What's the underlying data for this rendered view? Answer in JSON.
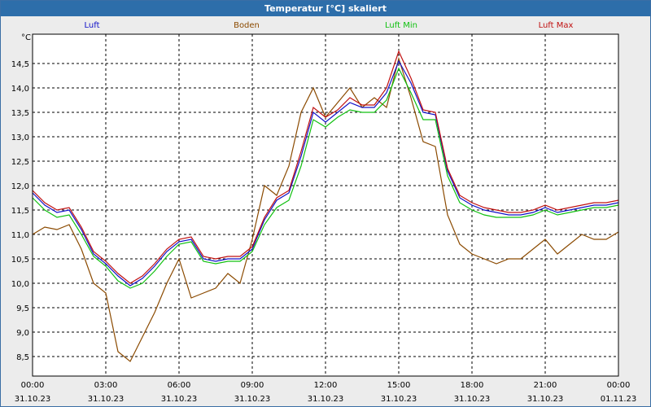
{
  "window": {
    "title": "Temperatur [°C] skaliert"
  },
  "chart_data": {
    "type": "line",
    "title": "Temperatur [°C] skaliert",
    "ylabel": "°C",
    "ylim": [
      8.1,
      15.1
    ],
    "yticks": [
      "8,5",
      "9,0",
      "9,5",
      "10,0",
      "10,5",
      "11,0",
      "11,5",
      "12,0",
      "12,5",
      "13,0",
      "13,5",
      "14,0",
      "14,5"
    ],
    "ytick_values": [
      8.5,
      9.0,
      9.5,
      10.0,
      10.5,
      11.0,
      11.5,
      12.0,
      12.5,
      13.0,
      13.5,
      14.0,
      14.5
    ],
    "xlim_hours": [
      0,
      24
    ],
    "xtick_hours": [
      0,
      3,
      6,
      9,
      12,
      15,
      18,
      21,
      24
    ],
    "xticks": [
      {
        "time": "00:00",
        "date": "31.10.23"
      },
      {
        "time": "03:00",
        "date": "31.10.23"
      },
      {
        "time": "06:00",
        "date": "31.10.23"
      },
      {
        "time": "09:00",
        "date": "31.10.23"
      },
      {
        "time": "12:00",
        "date": "31.10.23"
      },
      {
        "time": "15:00",
        "date": "31.10.23"
      },
      {
        "time": "18:00",
        "date": "31.10.23"
      },
      {
        "time": "21:00",
        "date": "31.10.23"
      },
      {
        "time": "00:00",
        "date": "01.11.23"
      }
    ],
    "grid": true,
    "legend_position": "top",
    "x_hours": [
      0,
      0.5,
      1,
      1.5,
      2,
      2.5,
      3,
      3.5,
      4,
      4.5,
      5,
      5.5,
      6,
      6.5,
      7,
      7.5,
      8,
      8.5,
      9,
      9.5,
      10,
      10.5,
      11,
      11.5,
      12,
      12.5,
      13,
      13.5,
      14,
      14.5,
      15,
      15.5,
      16,
      16.5,
      17,
      17.5,
      18,
      18.5,
      19,
      19.5,
      20,
      20.5,
      21,
      21.5,
      22,
      22.5,
      23,
      23.5,
      24
    ],
    "series": [
      {
        "name": "Luft",
        "color": "#1010c8",
        "values": [
          11.85,
          11.6,
          11.45,
          11.5,
          11.1,
          10.6,
          10.4,
          10.15,
          9.95,
          10.1,
          10.35,
          10.65,
          10.85,
          10.9,
          10.5,
          10.45,
          10.5,
          10.5,
          10.7,
          11.3,
          11.7,
          11.85,
          12.6,
          13.5,
          13.3,
          13.5,
          13.7,
          13.6,
          13.6,
          13.9,
          14.55,
          14.1,
          13.5,
          13.45,
          12.3,
          11.75,
          11.6,
          11.5,
          11.45,
          11.4,
          11.4,
          11.45,
          11.55,
          11.45,
          11.5,
          11.55,
          11.6,
          11.6,
          11.65
        ]
      },
      {
        "name": "Boden",
        "color": "#8b4a00",
        "values": [
          11.0,
          11.15,
          11.1,
          11.2,
          10.7,
          10.0,
          9.8,
          8.6,
          8.4,
          8.9,
          9.4,
          10.0,
          10.5,
          9.7,
          9.8,
          9.9,
          10.2,
          10.0,
          10.9,
          12.0,
          11.8,
          12.4,
          13.5,
          14.0,
          13.4,
          13.7,
          14.0,
          13.6,
          13.8,
          13.6,
          14.6,
          13.8,
          12.9,
          12.8,
          11.4,
          10.8,
          10.6,
          10.5,
          10.4,
          10.5,
          10.5,
          10.7,
          10.9,
          10.6,
          10.8,
          11.0,
          10.9,
          10.9,
          11.05
        ]
      },
      {
        "name": "Luft Min",
        "color": "#10c010",
        "values": [
          11.75,
          11.5,
          11.35,
          11.4,
          11.0,
          10.55,
          10.35,
          10.05,
          9.9,
          10.0,
          10.25,
          10.55,
          10.8,
          10.85,
          10.45,
          10.4,
          10.45,
          10.45,
          10.65,
          11.2,
          11.55,
          11.7,
          12.4,
          13.35,
          13.2,
          13.4,
          13.55,
          13.5,
          13.5,
          13.75,
          14.4,
          13.9,
          13.35,
          13.35,
          12.2,
          11.65,
          11.5,
          11.4,
          11.35,
          11.35,
          11.35,
          11.4,
          11.5,
          11.4,
          11.45,
          11.5,
          11.55,
          11.55,
          11.6
        ]
      },
      {
        "name": "Luft Max",
        "color": "#c01010",
        "values": [
          11.9,
          11.65,
          11.5,
          11.55,
          11.15,
          10.65,
          10.45,
          10.2,
          10.0,
          10.15,
          10.4,
          10.7,
          10.9,
          10.95,
          10.55,
          10.5,
          10.55,
          10.55,
          10.75,
          11.35,
          11.75,
          11.9,
          12.7,
          13.6,
          13.4,
          13.55,
          13.8,
          13.65,
          13.65,
          14.0,
          14.75,
          14.2,
          13.55,
          13.5,
          12.35,
          11.8,
          11.65,
          11.55,
          11.5,
          11.45,
          11.45,
          11.5,
          11.6,
          11.5,
          11.55,
          11.6,
          11.65,
          11.65,
          11.7
        ]
      }
    ]
  }
}
